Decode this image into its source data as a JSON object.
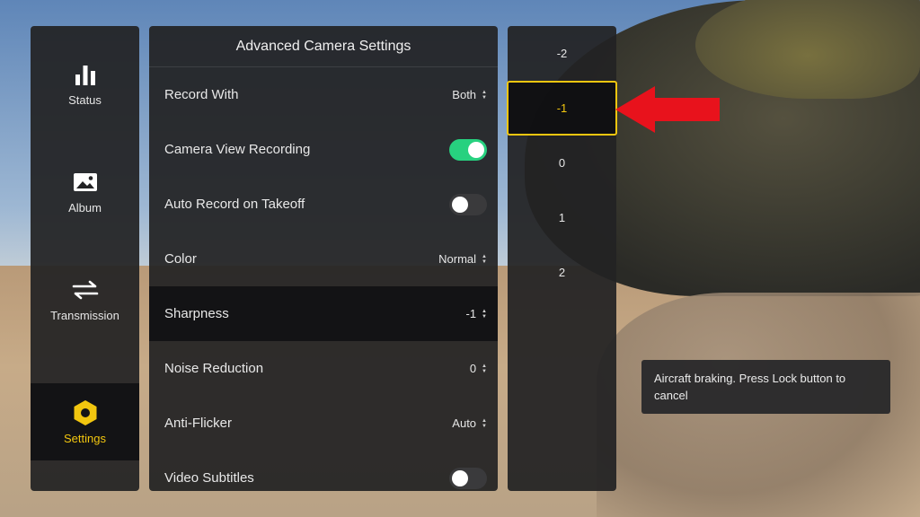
{
  "sidebar": {
    "items": [
      {
        "label": "Status",
        "icon": "bar-chart-icon",
        "active": false
      },
      {
        "label": "Album",
        "icon": "image-icon",
        "active": false
      },
      {
        "label": "Transmission",
        "icon": "transfer-arrows-icon",
        "active": false
      },
      {
        "label": "Settings",
        "icon": "hexagon-gear-icon",
        "active": true
      }
    ]
  },
  "settings": {
    "title": "Advanced Camera Settings",
    "rows": [
      {
        "label": "Record With",
        "value": "Both",
        "type": "select"
      },
      {
        "label": "Camera View Recording",
        "type": "toggle",
        "on": true
      },
      {
        "label": "Auto Record on Takeoff",
        "type": "toggle",
        "on": false
      },
      {
        "label": "Color",
        "value": "Normal",
        "type": "select"
      },
      {
        "label": "Sharpness",
        "value": "-1",
        "type": "select",
        "selected": true
      },
      {
        "label": "Noise Reduction",
        "value": "0",
        "type": "select"
      },
      {
        "label": "Anti-Flicker",
        "value": "Auto",
        "type": "select"
      },
      {
        "label": "Video Subtitles",
        "type": "toggle",
        "on": false
      }
    ]
  },
  "picker": {
    "options": [
      "-2",
      "-1",
      "0",
      "1",
      "2"
    ],
    "selected": "-1"
  },
  "toast": {
    "text": "Aircraft braking. Press Lock button to cancel"
  },
  "colors": {
    "accent": "#f2c60f",
    "toggle_on": "#27d17f",
    "annotation_arrow": "#e8121c"
  }
}
